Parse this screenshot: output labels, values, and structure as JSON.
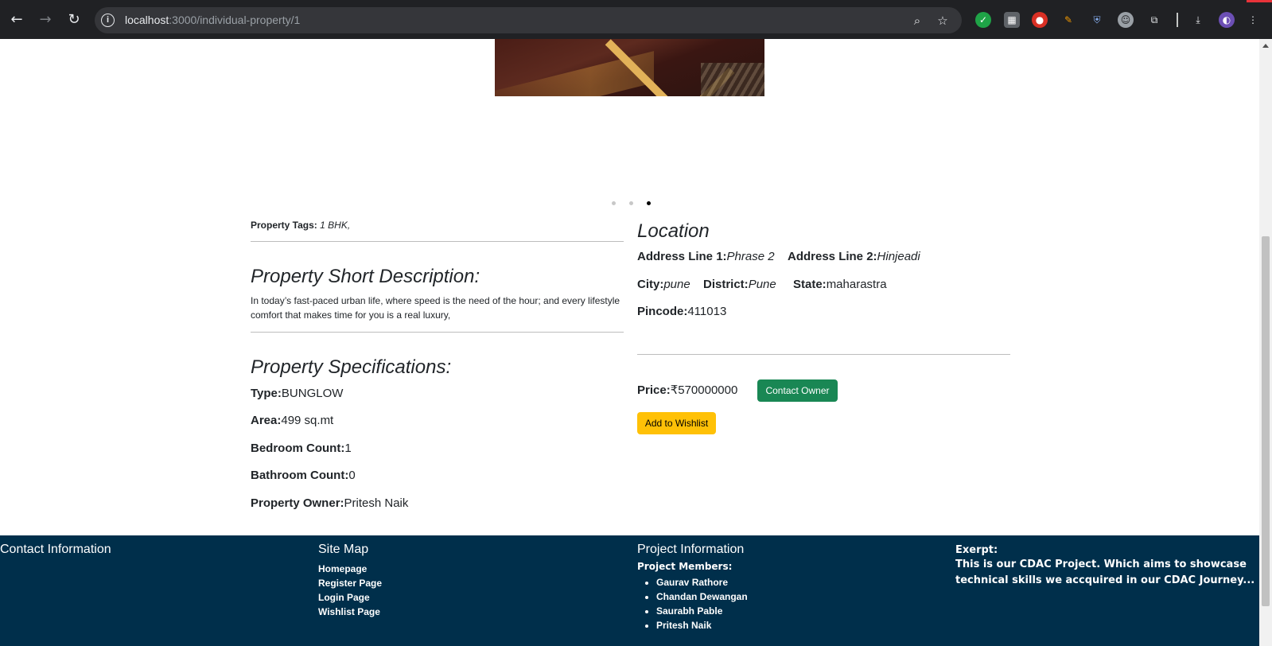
{
  "browser": {
    "url_host": "localhost",
    "url_path": ":3000/individual-property/1"
  },
  "property": {
    "tags_label": "Property Tags:",
    "tags_value": "1 BHK,",
    "short_desc_heading": "Property Short Description:",
    "short_desc_text": "In today’s fast-paced urban life, where speed is the need of the hour; and every lifestyle comfort that makes time for you is a real luxury,",
    "specs_heading": "Property Specifications:",
    "specs": {
      "type_label": "Type:",
      "type_value": "BUNGLOW",
      "area_label": "Area:",
      "area_value": "499 sq.mt",
      "bedroom_label": "Bedroom Count:",
      "bedroom_value": "1",
      "bathroom_label": "Bathroom Count:",
      "bathroom_value": "0",
      "owner_label": "Property Owner:",
      "owner_value": "Pritesh Naik"
    }
  },
  "location": {
    "heading": "Location",
    "address1_label": "Address Line 1:",
    "address1_value": "Phrase 2",
    "address2_label": "Address Line 2:",
    "address2_value": "Hinjeadi",
    "city_label": "City:",
    "city_value": "pune",
    "district_label": "District:",
    "district_value": "Pune",
    "state_label": "State:",
    "state_value": "maharastra",
    "pincode_label": "Pincode:",
    "pincode_value": "411013",
    "price_label": "Price:",
    "price_value": "₹570000000",
    "contact_button": "Contact Owner",
    "wishlist_button": "Add to Wishlist"
  },
  "carousel": {
    "active_index": 3,
    "count": 3
  },
  "footer": {
    "contact_title": "Contact Information",
    "sitemap_title": "Site Map",
    "sitemap_links": [
      "Homepage",
      "Register Page",
      "Login Page",
      "Wishlist Page"
    ],
    "project_title": "Project Information",
    "members_heading": "Project Members:",
    "members": [
      "Gaurav Rathore",
      "Chandan Dewangan",
      "Saurabh Pable",
      "Pritesh Naik"
    ],
    "excerpt_heading": "Exerpt:",
    "excerpt_text": "This is our CDAC Project. Which aims to showcase technical skills we accquired in our CDAC Journey..."
  },
  "colors": {
    "footer_bg": "#002f4b",
    "contact_button": "#198754",
    "wishlist_button": "#ffc107"
  }
}
